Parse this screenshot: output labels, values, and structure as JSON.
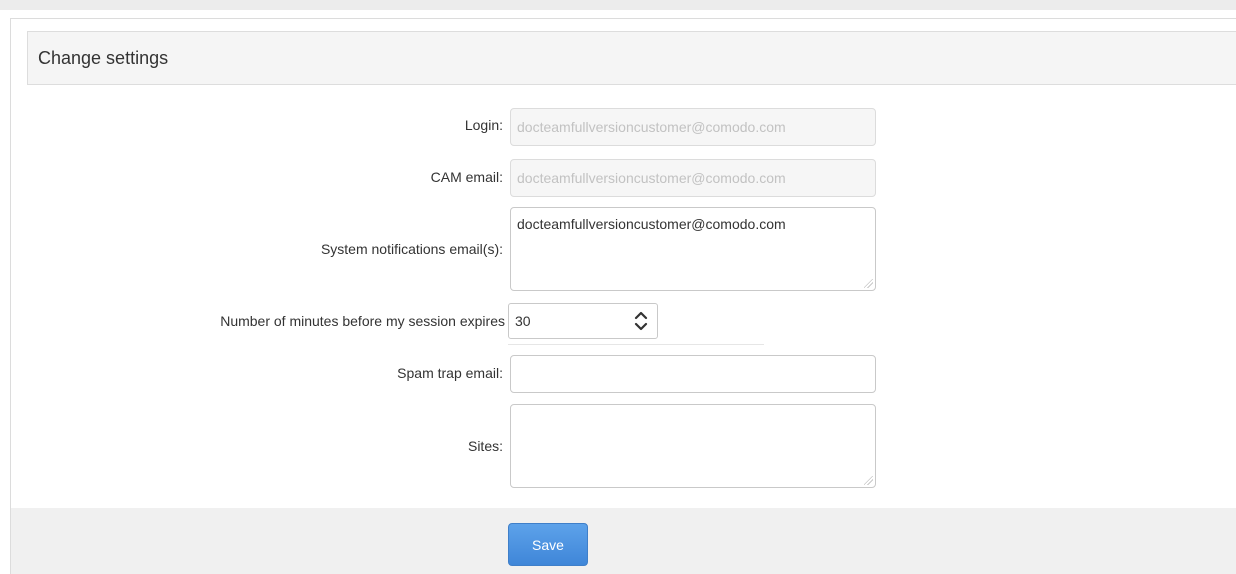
{
  "panel": {
    "title": "Change settings"
  },
  "form": {
    "login": {
      "label": "Login:",
      "value": "docteamfullversioncustomer@comodo.com"
    },
    "cam_email": {
      "label": "CAM email:",
      "value": "docteamfullversioncustomer@comodo.com"
    },
    "system_notifications": {
      "label": "System notifications email(s):",
      "value": "docteamfullversioncustomer@comodo.com"
    },
    "session_minutes": {
      "label": "Number of minutes before my session expires",
      "value": "30",
      "icon": "updown-chevron-icon"
    },
    "spam_trap": {
      "label": "Spam trap email:",
      "value": ""
    },
    "sites": {
      "label": "Sites:",
      "value": ""
    }
  },
  "footer": {
    "save_label": "Save"
  },
  "colors": {
    "save_button": "#4a90e2",
    "header_bg": "#f5f5f5",
    "footer_bg": "#f0f0f0",
    "readonly_text": "#c2c2c2"
  }
}
